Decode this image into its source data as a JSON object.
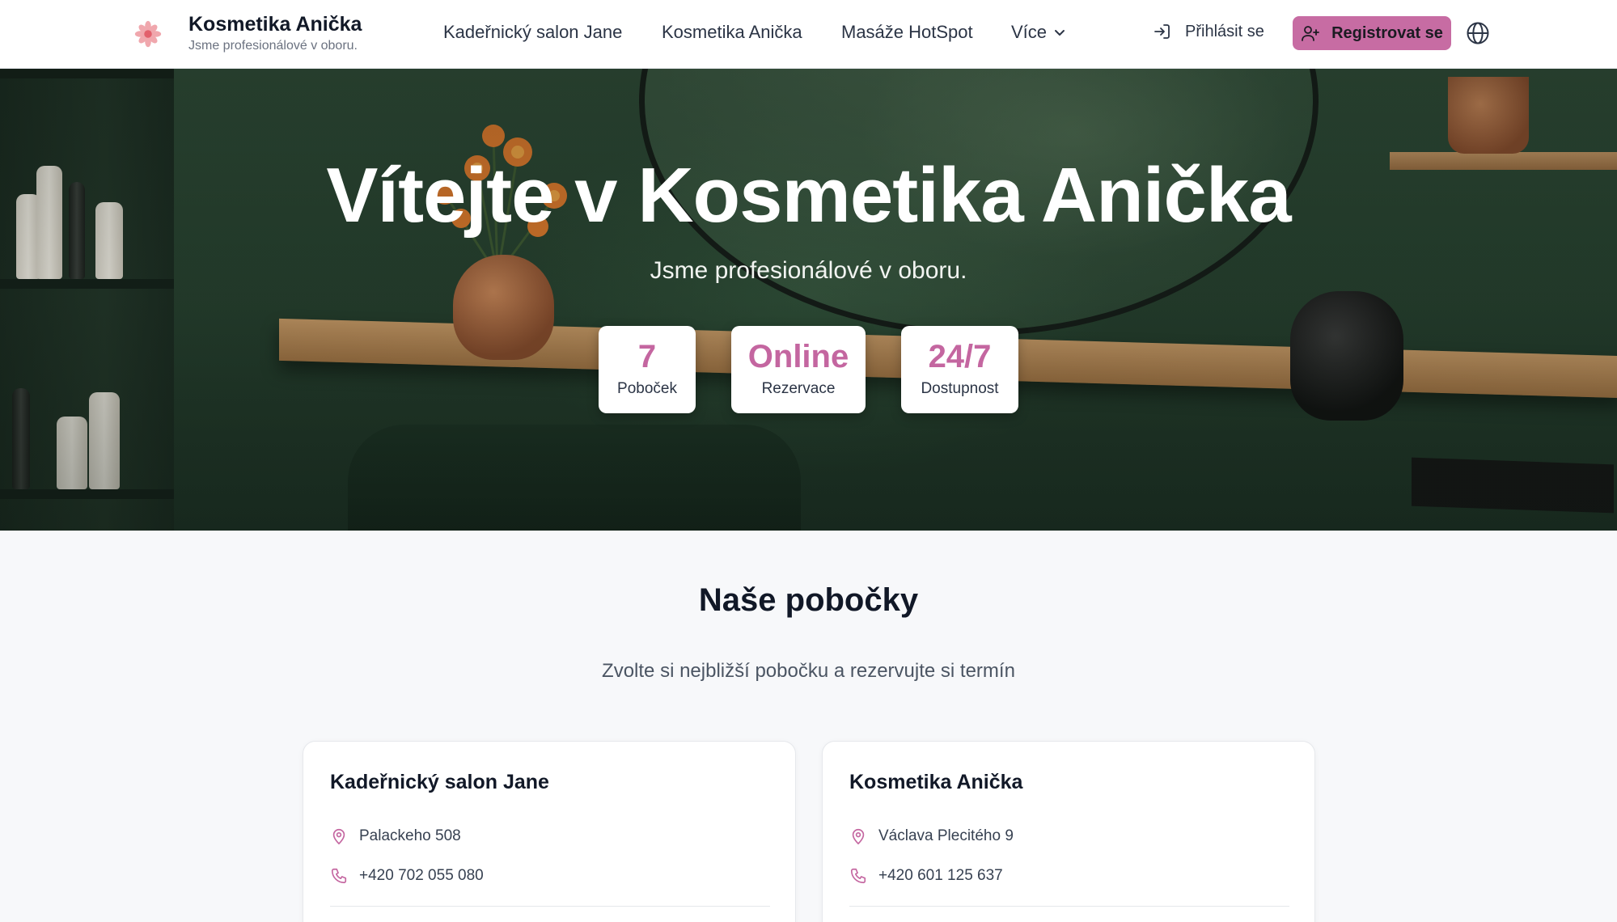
{
  "header": {
    "brand_title": "Kosmetika Anička",
    "brand_subtitle": "Jsme profesionálové v oboru.",
    "nav": [
      {
        "label": "Kadeřnický salon Jane"
      },
      {
        "label": "Kosmetika Anička"
      },
      {
        "label": "Masáže HotSpot"
      }
    ],
    "more_label": "Více",
    "login_label": "Přihlásit se",
    "register_label": "Registrovat se",
    "accent_color": "#c76ca3"
  },
  "hero": {
    "title": "Vítejte v Kosmetika Anička",
    "subtitle": "Jsme profesionálové v oboru.",
    "stats": [
      {
        "value": "7",
        "label": "Poboček"
      },
      {
        "value": "Online",
        "label": "Rezervace"
      },
      {
        "value": "24/7",
        "label": "Dostupnost"
      }
    ]
  },
  "branches": {
    "title": "Naše pobočky",
    "subtitle": "Zvolte si nejbližší pobočku a rezervujte si termín",
    "cards": [
      {
        "name": "Kadeřnický salon Jane",
        "address": "Palackeho 508",
        "phone": "+420 702 055 080"
      },
      {
        "name": "Kosmetika Anička",
        "address": "Václava Plecitého 9",
        "phone": "+420 601 125 637"
      }
    ]
  }
}
